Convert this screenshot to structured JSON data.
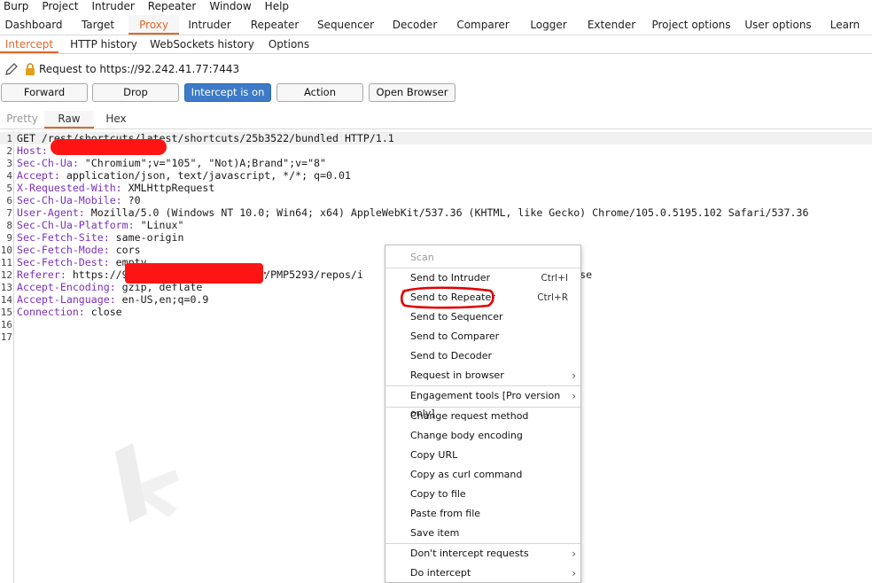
{
  "menubar": [
    "Burp",
    "Project",
    "Intruder",
    "Repeater",
    "Window",
    "Help"
  ],
  "tabs": [
    "Dashboard",
    "Target",
    "Proxy",
    "Intruder",
    "Repeater",
    "Sequencer",
    "Decoder",
    "Comparer",
    "Logger",
    "Extender",
    "Project options",
    "User options",
    "Learn"
  ],
  "active_tab": "Proxy",
  "subtabs": [
    "Intercept",
    "HTTP history",
    "WebSockets history",
    "Options"
  ],
  "active_subtab": "Intercept",
  "request_label": "Request to https://92.242.41.77:7443",
  "buttons": {
    "forward": "Forward",
    "drop": "Drop",
    "intercept": "Intercept is on",
    "action": "Action",
    "open_browser": "Open Browser"
  },
  "view_tabs": [
    "Pretty",
    "Raw",
    "Hex"
  ],
  "active_view_tab": "Raw",
  "request_lines": [
    {
      "n": "1",
      "name": "",
      "value": "GET /rest/shortcuts/latest/shortcuts/25b3522/bundled HTTP/1.1"
    },
    {
      "n": "2",
      "name": "Host:",
      "value": ""
    },
    {
      "n": "3",
      "name": "Sec-Ch-Ua:",
      "value": " \"Chromium\";v=\"105\", \"Not)A;Brand\";v=\"8\""
    },
    {
      "n": "4",
      "name": "Accept:",
      "value": " application/json, text/javascript, */*; q=0.01"
    },
    {
      "n": "5",
      "name": "X-Requested-With:",
      "value": " XMLHttpRequest"
    },
    {
      "n": "6",
      "name": "Sec-Ch-Ua-Mobile:",
      "value": " ?0"
    },
    {
      "n": "7",
      "name": "User-Agent:",
      "value": " Mozilla/5.0 (Windows NT 10.0; Win64; x64) AppleWebKit/537.36 (KHTML, like Gecko) Chrome/105.0.5195.102 Safari/537.36"
    },
    {
      "n": "8",
      "name": "Sec-Ch-Ua-Platform:",
      "value": " \"Linux\""
    },
    {
      "n": "9",
      "name": "Sec-Fetch-Site:",
      "value": " same-origin"
    },
    {
      "n": "10",
      "name": "Sec-Fetch-Mode:",
      "value": " cors"
    },
    {
      "n": "11",
      "name": "Sec-Fetch-Dest:",
      "value": " empty"
    },
    {
      "n": "12",
      "name": "Referer:",
      "value": " https://9                  ects/PMP5293/repos/i                        g_6020/browse"
    },
    {
      "n": "13",
      "name": "Accept-Encoding:",
      "value": " gzip, deflate"
    },
    {
      "n": "14",
      "name": "Accept-Language:",
      "value": " en-US,en;q=0.9"
    },
    {
      "n": "15",
      "name": "Connection:",
      "value": " close"
    },
    {
      "n": "16",
      "name": "",
      "value": ""
    },
    {
      "n": "17",
      "name": "",
      "value": ""
    }
  ],
  "context_menu": {
    "items": [
      {
        "label": "Scan",
        "shortcut": "",
        "submenu": false,
        "disabled": true
      },
      {
        "label": "Send to Intruder",
        "shortcut": "Ctrl+I",
        "submenu": false,
        "disabled": false
      },
      {
        "label": "Send to Repeater",
        "shortcut": "Ctrl+R",
        "submenu": false,
        "disabled": false
      },
      {
        "label": "Send to Sequencer",
        "shortcut": "",
        "submenu": false,
        "disabled": false
      },
      {
        "label": "Send to Comparer",
        "shortcut": "",
        "submenu": false,
        "disabled": false
      },
      {
        "label": "Send to Decoder",
        "shortcut": "",
        "submenu": false,
        "disabled": false
      },
      {
        "label": "Request in browser",
        "shortcut": "",
        "submenu": true,
        "disabled": false
      },
      {
        "label": "Engagement tools [Pro version only]",
        "shortcut": "",
        "submenu": true,
        "disabled": false
      },
      {
        "label": "Change request method",
        "shortcut": "",
        "submenu": false,
        "disabled": false
      },
      {
        "label": "Change body encoding",
        "shortcut": "",
        "submenu": false,
        "disabled": false
      },
      {
        "label": "Copy URL",
        "shortcut": "",
        "submenu": false,
        "disabled": false
      },
      {
        "label": "Copy as curl command",
        "shortcut": "",
        "submenu": false,
        "disabled": false
      },
      {
        "label": "Copy to file",
        "shortcut": "",
        "submenu": false,
        "disabled": false
      },
      {
        "label": "Paste from file",
        "shortcut": "",
        "submenu": false,
        "disabled": false
      },
      {
        "label": "Save item",
        "shortcut": "",
        "submenu": false,
        "disabled": false
      },
      {
        "label": "Don't intercept requests",
        "shortcut": "",
        "submenu": true,
        "disabled": false
      },
      {
        "label": "Do intercept",
        "shortcut": "",
        "submenu": true,
        "disabled": false
      }
    ]
  },
  "colors": {
    "accent": "#e0682b",
    "primary_button": "#3d7ac7",
    "header_name": "#7b2fbf",
    "redaction": "#ff1414",
    "annotation_circle": "#e00000"
  },
  "icons": [
    "pencil-icon",
    "lock-icon",
    "chevron-right-icon"
  ]
}
